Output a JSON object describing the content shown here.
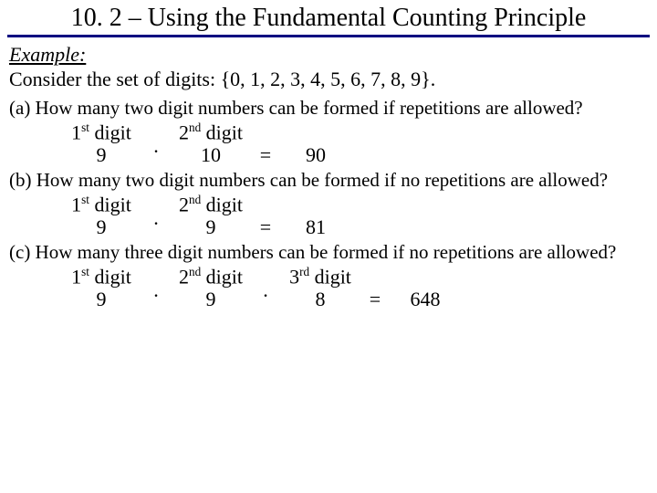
{
  "title": "10. 2 – Using the Fundamental Counting Principle",
  "example_label": "Example:",
  "consider": "Consider the set of digits:  {0, 1, 2, 3, 4, 5, 6, 7, 8, 9}.",
  "qa": "(a) How many two digit numbers can be formed if repetitions are allowed?",
  "qb": "(b) How many two digit numbers can be formed if no repetitions are allowed?",
  "qc": "(c) How many three digit numbers can be formed if no repetitions are allowed?",
  "labels": {
    "d1_pre": "1",
    "d1_sup": "st",
    "d1_post": "  digit",
    "d2_pre": "2",
    "d2_sup": "nd",
    "d2_post": " digit",
    "d3_pre": "3",
    "d3_sup": "rd",
    "d3_post": " digit"
  },
  "a": {
    "v1": "9",
    "op1": "·",
    "v2": "10",
    "eq": "=",
    "ans": "90"
  },
  "b": {
    "v1": "9",
    "op1": "·",
    "v2": "9",
    "eq": "=",
    "ans": "81"
  },
  "c": {
    "v1": "9",
    "op1": "·",
    "v2": "9",
    "op2": "·",
    "v3": "8",
    "eq": "=",
    "ans": "648"
  }
}
